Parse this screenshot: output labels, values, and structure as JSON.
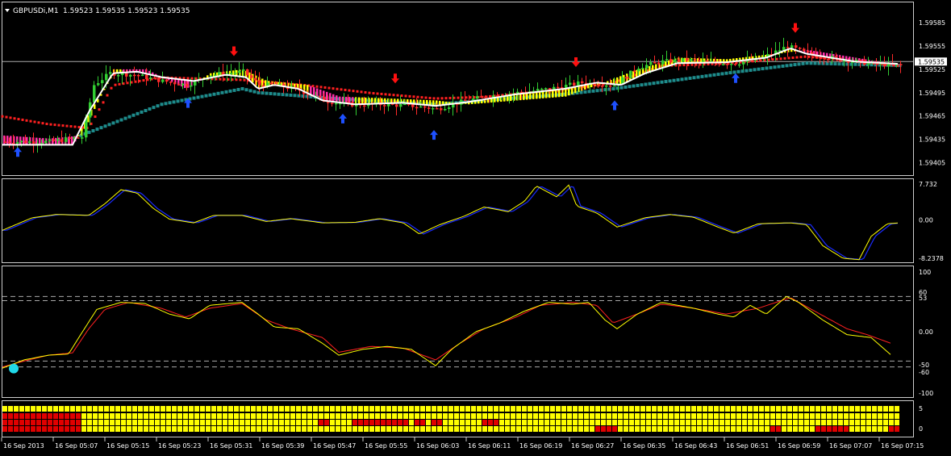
{
  "chart_data": [
    {
      "type": "candlestick",
      "symbol_label": "GBPUSDi,M1",
      "ohlc_label": "1.59523 1.59535 1.59523 1.59535",
      "ylim": [
        1.5939,
        1.5961
      ],
      "y_ticks": [
        "1.59585",
        "1.59555",
        "1.59525",
        "1.59495",
        "1.59465",
        "1.59435",
        "1.59405"
      ],
      "y_tick_values": [
        1.59585,
        1.59555,
        1.59525,
        1.59495,
        1.59465,
        1.59435,
        1.59405
      ],
      "current_price_label": "1.59535",
      "current_price": 1.59535,
      "colors": {
        "bull": "#32cd32",
        "bear": "#ff2a2a",
        "ma_red": "#ff2020",
        "ma_teal": "#1e8c8c",
        "ma_white": "#ffffff",
        "hist_pink": "#ff2da8",
        "hist_yellow": "#ffff00",
        "up_arrow": "#1e50ff",
        "down_arrow": "#ff1010"
      }
    },
    {
      "type": "line",
      "y_ticks": [
        "7.732",
        "0.00",
        "-8.2378"
      ],
      "y_tick_values": [
        7.732,
        0,
        -8.2378
      ],
      "ylim": [
        -8.9,
        8.6
      ],
      "colors": {
        "line1": "#1a2bff",
        "line2": "#ffff00"
      }
    },
    {
      "type": "line",
      "y_ticks": [
        "100",
        "60",
        "53",
        "0.00",
        "-50",
        "-60",
        "-100"
      ],
      "y_tick_values": [
        100,
        60,
        53,
        0,
        -50,
        -60,
        -100
      ],
      "levels": [
        60,
        53,
        -50,
        -60
      ],
      "ylim": [
        -110,
        110
      ],
      "marker_value": -60,
      "colors": {
        "line1": "#ffff00",
        "line2": "#ff2020",
        "level": "#aaaaaa",
        "marker": "#20d8e8"
      }
    },
    {
      "type": "heatmap",
      "y_ticks": [
        "5",
        "0"
      ],
      "rows": 4,
      "colors": {
        "yellow": "#ffff00",
        "red": "#e00000"
      },
      "red_runs": [
        [],
        [
          [
            0,
            14
          ]
        ],
        [
          [
            0,
            14
          ],
          [
            56,
            58
          ],
          [
            62,
            72
          ],
          [
            73,
            75
          ],
          [
            76,
            78
          ],
          [
            85,
            88
          ]
        ],
        [
          [
            0,
            14
          ],
          [
            105,
            109
          ],
          [
            136,
            138
          ],
          [
            144,
            150
          ],
          [
            157,
            160
          ]
        ]
      ]
    }
  ],
  "time_axis": {
    "labels": [
      "16 Sep 2013",
      "16 Sep 05:07",
      "16 Sep 05:15",
      "16 Sep 05:23",
      "16 Sep 05:31",
      "16 Sep 05:39",
      "16 Sep 05:47",
      "16 Sep 05:55",
      "16 Sep 06:03",
      "16 Sep 06:11",
      "16 Sep 06:19",
      "16 Sep 06:27",
      "16 Sep 06:35",
      "16 Sep 06:43",
      "16 Sep 06:51",
      "16 Sep 06:59",
      "16 Sep 07:07",
      "16 Sep 07:15"
    ]
  }
}
